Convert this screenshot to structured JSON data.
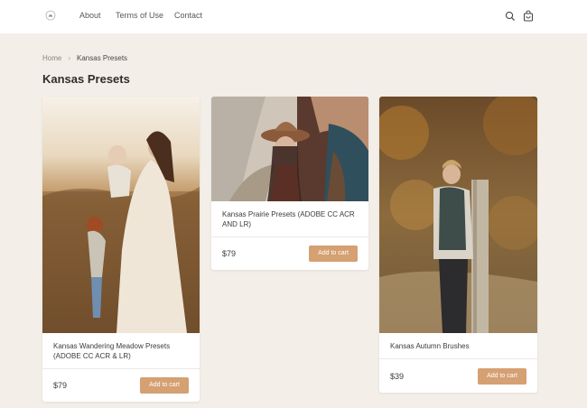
{
  "header": {
    "nav": [
      {
        "label": "About"
      },
      {
        "label": "Terms of Use"
      },
      {
        "label": "Contact"
      }
    ],
    "icons": [
      "logo-icon",
      "search-icon",
      "shopping-bag-icon"
    ]
  },
  "breadcrumb": {
    "home": "Home",
    "separator": "›",
    "current": "Kansas Presets"
  },
  "page": {
    "title": "Kansas Presets"
  },
  "products": [
    {
      "title": "Kansas Wandering Meadow Presets (ADOBE CC ACR & LR)",
      "price": "$79",
      "button": "Add to cart"
    },
    {
      "title": "Kansas Prairie Presets (ADOBE CC ACR AND LR)",
      "price": "$79",
      "button": "Add to cart"
    },
    {
      "title": "Kansas Autumn Brushes",
      "price": "$39",
      "button": "Add to cart"
    }
  ],
  "colors": {
    "page_background": "#f3eee8",
    "header_background": "#ffffff",
    "accent_button": "#d5a072",
    "text_primary": "#2f2d2b"
  }
}
